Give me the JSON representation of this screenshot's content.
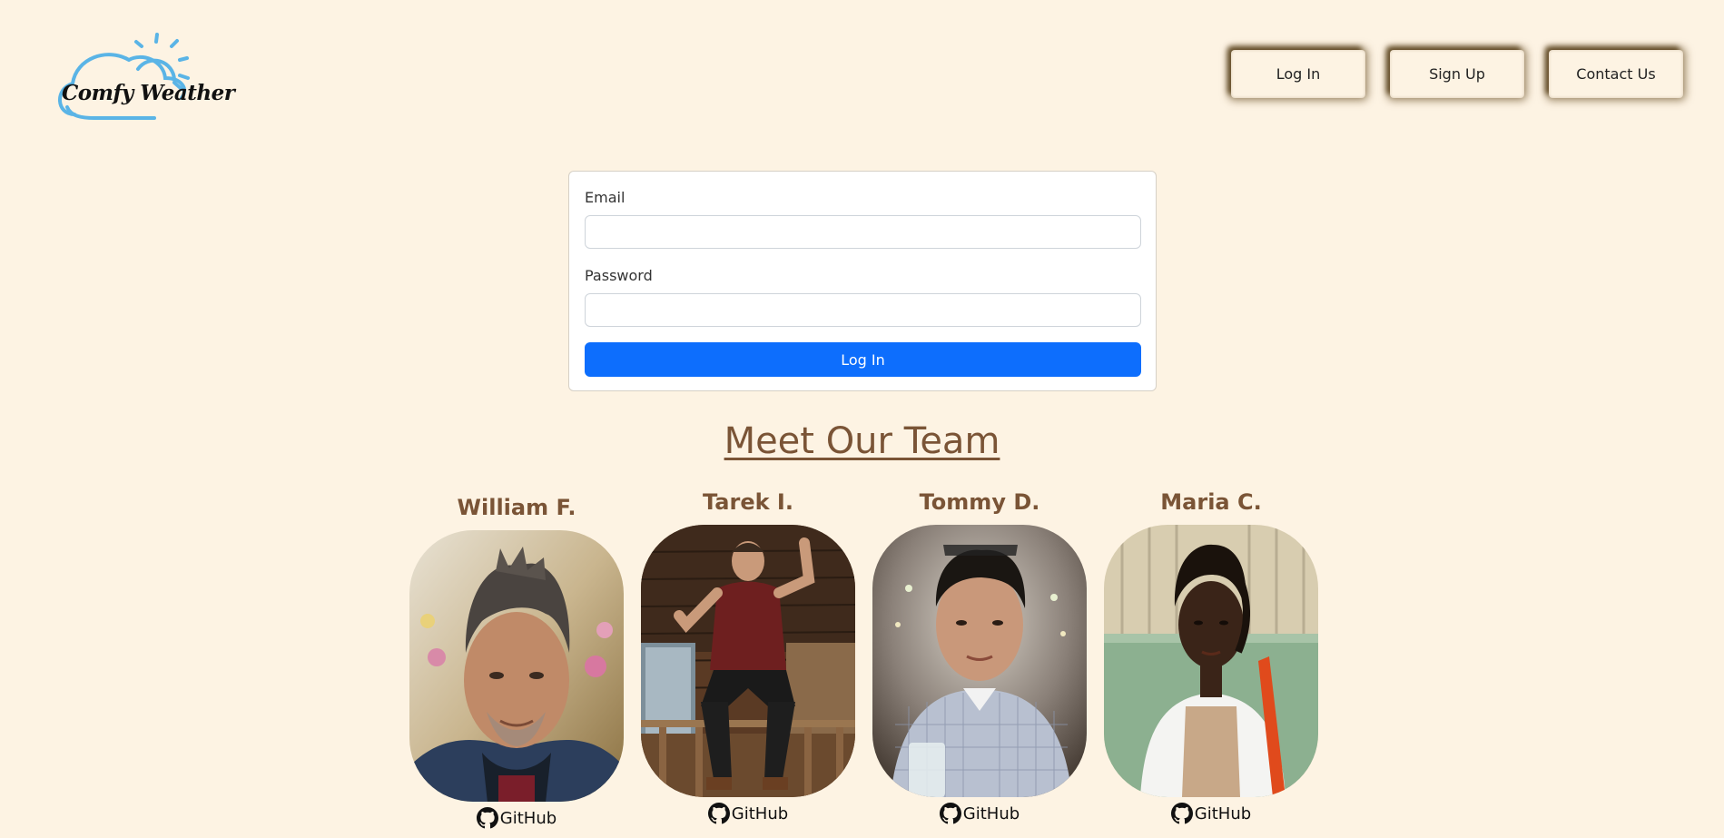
{
  "header": {
    "logo_text": "Comfy Weather",
    "nav": [
      {
        "label": "Log In"
      },
      {
        "label": "Sign Up"
      },
      {
        "label": "Contact Us"
      }
    ]
  },
  "login_form": {
    "email_label": "Email",
    "email_value": "",
    "password_label": "Password",
    "password_value": "",
    "submit_label": "Log In"
  },
  "team": {
    "title": "Meet Our Team",
    "members": [
      {
        "name": "William F.",
        "link_label": "GitHub"
      },
      {
        "name": "Tarek I.",
        "link_label": "GitHub"
      },
      {
        "name": "Tommy D.",
        "link_label": "GitHub"
      },
      {
        "name": "Maria C.",
        "link_label": "GitHub"
      }
    ]
  },
  "colors": {
    "background": "#fdf3e3",
    "accent_brown": "#7a5436",
    "primary_button": "#0d6efd",
    "logo_blue": "#5ab4e6"
  },
  "icons": {
    "logo": "cloud-sun-icon",
    "github": "github-icon"
  }
}
